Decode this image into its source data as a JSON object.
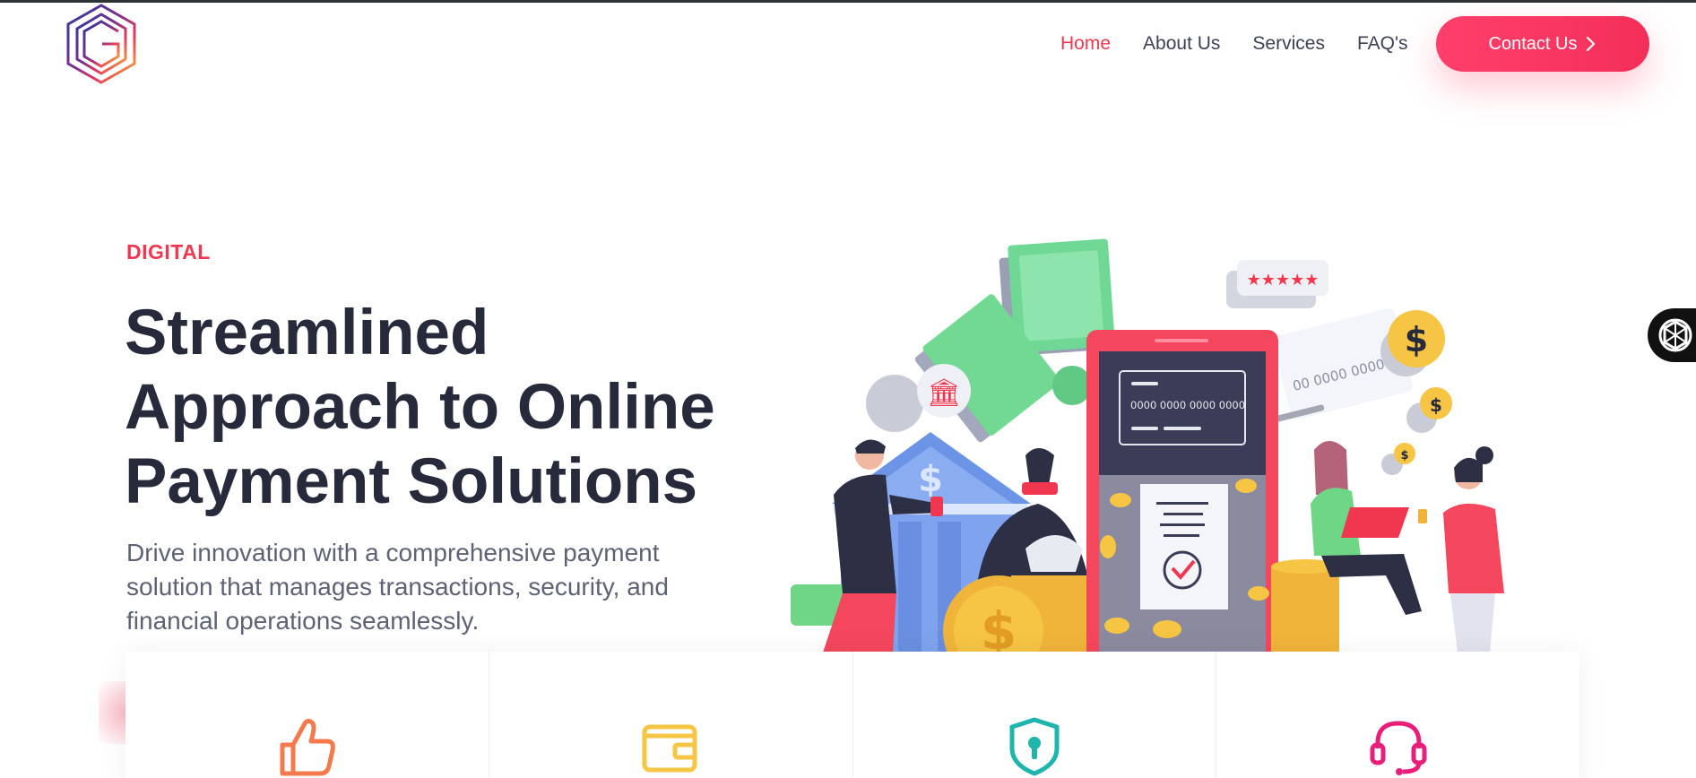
{
  "header": {
    "logo_icon": "hexagon-logo-icon",
    "nav": [
      {
        "label": "Home",
        "active": true
      },
      {
        "label": "About Us",
        "active": false
      },
      {
        "label": "Services",
        "active": false
      },
      {
        "label": "FAQ's",
        "active": false
      }
    ],
    "contact_label": "Contact Us",
    "contact_icon": "chevron-right-icon"
  },
  "hero": {
    "eyebrow": "DIGITAL",
    "headline_lines": [
      "Streamlined",
      "Approach to Online",
      "Payment Solutions"
    ],
    "subtext": "Drive innovation with a comprehensive payment solution that manages transactions, security, and financial operations seamlessly.",
    "illustration": {
      "card_number": "0000 0000 0000 0000",
      "card_number_partial": "00 0000 0000",
      "currency_symbol": "$"
    }
  },
  "features": [
    {
      "icon": "thumbs-up-icon"
    },
    {
      "icon": "wallet-icon"
    },
    {
      "icon": "shield-lock-icon"
    },
    {
      "icon": "headset-icon"
    }
  ],
  "side_widget": {
    "icon": "openai-logo-icon"
  },
  "colors": {
    "accent": "#f1374f",
    "heading": "#262a3b",
    "body": "#5d6275",
    "button_gradient_start": "#ff3f6b",
    "button_gradient_end": "#f32f59"
  }
}
